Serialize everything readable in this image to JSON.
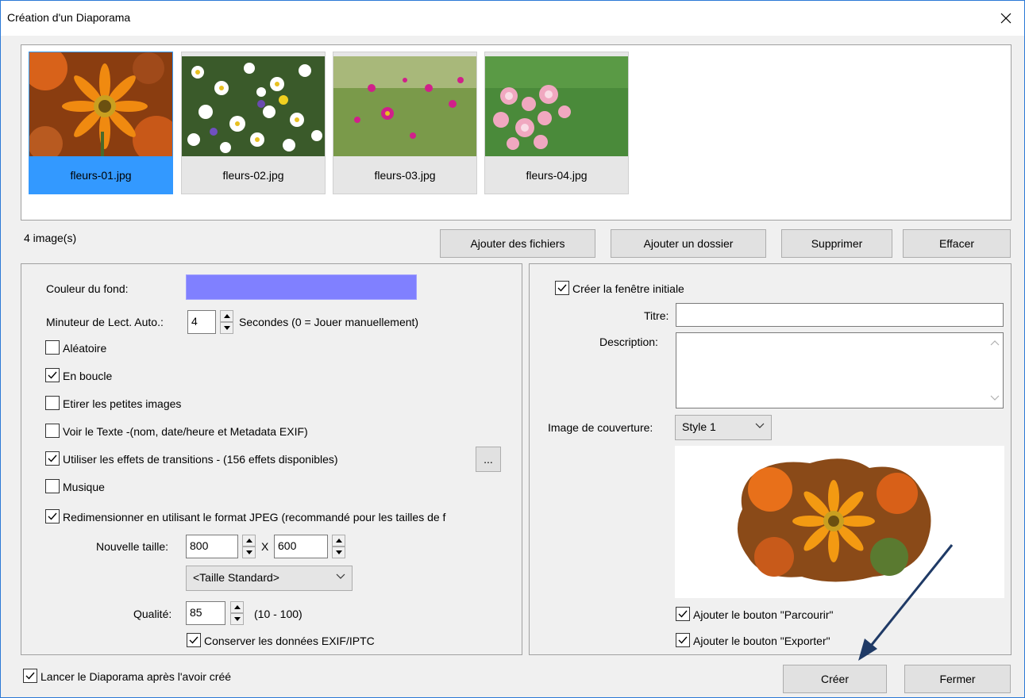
{
  "window": {
    "title": "Création d'un Diaporama"
  },
  "thumbnails": [
    {
      "filename": "fleurs-01.jpg",
      "selected": true
    },
    {
      "filename": "fleurs-02.jpg",
      "selected": false
    },
    {
      "filename": "fleurs-03.jpg",
      "selected": false
    },
    {
      "filename": "fleurs-04.jpg",
      "selected": false
    }
  ],
  "image_count": "4 image(s)",
  "file_buttons": {
    "add_files": "Ajouter des fichiers",
    "add_folder": "Ajouter un dossier",
    "remove": "Supprimer",
    "clear": "Effacer"
  },
  "left_panel": {
    "bg_color_label": "Couleur du fond:",
    "bg_color": "#8080ff",
    "timer_label": "Minuteur de Lect. Auto.:",
    "timer_value": "4",
    "timer_suffix": "Secondes (0 = Jouer  manuellement)",
    "options": {
      "random": {
        "label": "Aléatoire",
        "checked": false
      },
      "loop": {
        "label": "En boucle",
        "checked": true
      },
      "stretch": {
        "label": "Etirer les petites images",
        "checked": false
      },
      "show_text": {
        "label": "Voir le Texte -(nom, date/heure et Metadata EXIF)",
        "checked": false
      },
      "transitions": {
        "label": "Utiliser les effets de transitions  -  (156 effets disponibles)",
        "checked": true
      },
      "music": {
        "label": "Musique",
        "checked": false
      },
      "resize": {
        "label": "Redimensionner en utilisant le format JPEG (recommandé pour les tailles de f",
        "checked": true
      }
    },
    "more_button": "...",
    "new_size_label": "Nouvelle taille:",
    "width": "800",
    "x_sep": "X",
    "height": "600",
    "size_preset": "<Taille Standard>",
    "quality_label": "Qualité:",
    "quality": "85",
    "quality_range": "(10 - 100)",
    "keep_exif": {
      "label": "Conserver les données EXIF/IPTC",
      "checked": true
    }
  },
  "right_panel": {
    "create_initial": {
      "label": "Créer la fenêtre initiale",
      "checked": true
    },
    "title_label": "Titre:",
    "title_value": "",
    "description_label": "Description:",
    "description_value": "",
    "cover_label": "Image de couverture:",
    "cover_style": "Style 1",
    "browse_button": {
      "label": "Ajouter le bouton \"Parcourir\"",
      "checked": true
    },
    "export_button": {
      "label": "Ajouter le bouton \"Exporter\"",
      "checked": true
    }
  },
  "footer": {
    "launch_after": {
      "label": "Lancer le Diaporama après l'avoir créé",
      "checked": true
    },
    "create": "Créer",
    "close": "Fermer"
  }
}
